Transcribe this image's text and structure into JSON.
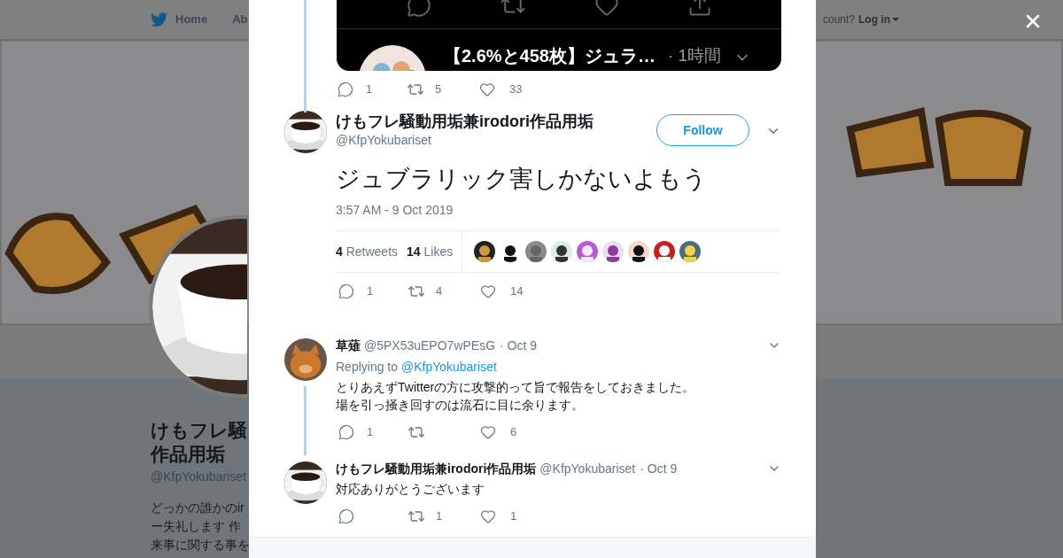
{
  "header": {
    "nav": [
      {
        "label": "Home"
      },
      {
        "label": "Ab"
      }
    ],
    "login_prompt": "count?",
    "login": "Log in"
  },
  "profile": {
    "name_lines": [
      "けもフレ騒",
      "作品用垢"
    ],
    "handle": "@KfpYokubariset",
    "bio_lines": [
      "どっかの誰かのir",
      "ー失礼します 作",
      "来事に関する事を"
    ]
  },
  "modal": {
    "quoted_card": {
      "title": "【2.6%と458枚】ジュラ…",
      "time": "· 1時間"
    },
    "prev_actions": {
      "replies": "1",
      "retweets": "5",
      "likes": "33"
    },
    "main_tweet": {
      "name": "けもフレ騒動用垢兼irodori作品用垢",
      "handle": "@KfpYokubariset",
      "follow": "Follow",
      "text": "ジュブラリック害しかないよもう",
      "timestamp": "3:57 AM - 9 Oct 2019",
      "retweets_count": "4",
      "retweets_label": "Retweets",
      "likes_count": "14",
      "likes_label": "Likes",
      "actions": {
        "replies": "1",
        "retweets": "4",
        "likes": "14"
      }
    },
    "replies": [
      {
        "kind": "cat",
        "name": "草薙",
        "handle": "@5PX53uEPO7wPEsG",
        "date": "· Oct 9",
        "replying_label": "Replying to",
        "replying_to": "@KfpYokubariset",
        "text_lines": [
          "とりあえずTwitterの方に攻撃的って旨で報告をしておきました。",
          "場を引っ掻き回すのは流石に目に余ります。"
        ],
        "thread_line": true,
        "actions": {
          "replies": "1",
          "likes": "6"
        }
      },
      {
        "kind": "coffee",
        "name": "けもフレ騒動用垢兼irodori作品用垢",
        "handle": "@KfpYokubariset",
        "date": "· Oct 9",
        "text_lines": [
          "対応ありがとうございます"
        ],
        "thread_line": false,
        "actions": {
          "retweets": "1",
          "likes": "1"
        }
      }
    ]
  }
}
